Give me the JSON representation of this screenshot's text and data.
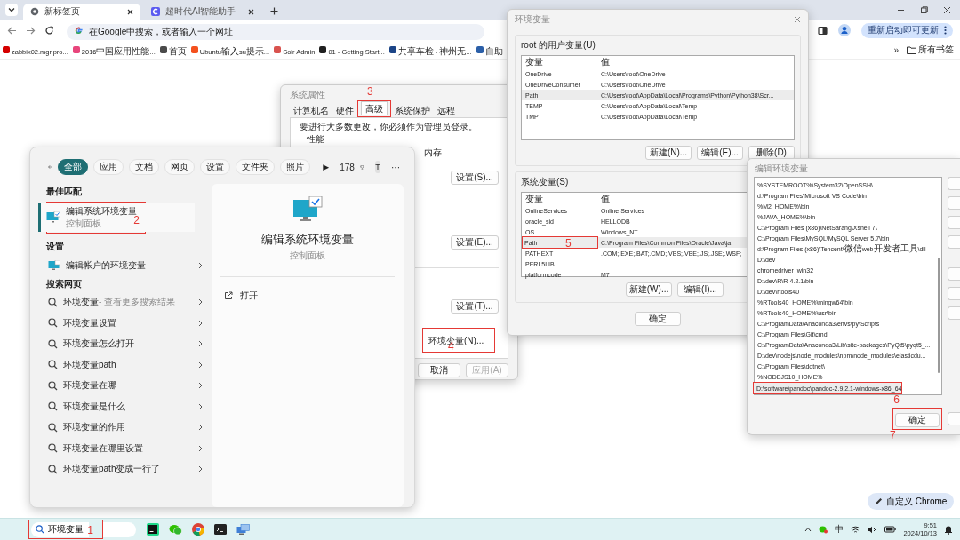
{
  "browser": {
    "tabs": [
      {
        "title": "新标签页",
        "selected": true,
        "kind": "newtab"
      },
      {
        "title": "超时代AI智能助手",
        "selected": false,
        "kind": "assistant"
      }
    ],
    "address_bar": {
      "placeholder": "在Google中搜索，或者输入一个网址"
    },
    "update_button": "重新启动即可更新",
    "bookmarks": [
      {
        "label": "zabbix02.mgr.pro...",
        "color": "#d50000"
      },
      {
        "label": "2016中国应用性能...",
        "color": "#e8457c"
      },
      {
        "label": "首页",
        "color": "#4a4a4a"
      },
      {
        "label": "Ubuntu输入su提示...",
        "color": "#f4511e"
      },
      {
        "label": "Solr Admin",
        "color": "#d9534f"
      },
      {
        "label": "01 - Getting Start...",
        "color": "#202020"
      },
      {
        "label": "共享车检 - 神州无...",
        "color": "#1c4587"
      },
      {
        "label": "自助",
        "color": "#2b5fa8"
      }
    ],
    "bookmarks_overflow": "»",
    "all_bookmarks": "所有书签",
    "customize_button": "自定义 Chrome"
  },
  "system_properties": {
    "title": "系统属性",
    "tabs": [
      {
        "label": "计算机名",
        "selected": false
      },
      {
        "label": "硬件",
        "selected": false
      },
      {
        "label": "高级",
        "selected": true,
        "step": "3"
      },
      {
        "label": "系统保护",
        "selected": false
      },
      {
        "label": "远程",
        "selected": false
      }
    ],
    "notice": "要进行大多数更改，你必须作为管理员登录。",
    "groups": [
      {
        "label": "性能",
        "fragment": "内存",
        "button": "设置(S)..."
      },
      {
        "button": "设置(E)..."
      },
      {
        "button": "设置(T)..."
      }
    ],
    "env_button": {
      "label": "环境变量(N)...",
      "step": "4"
    },
    "footer_buttons": [
      {
        "label": "取消",
        "disabled": false
      },
      {
        "label": "应用(A)",
        "disabled": true
      }
    ]
  },
  "environment_variables": {
    "title": "环境变量",
    "user_section": "root 的用户变量(U)",
    "user_columns": [
      "变量",
      "值"
    ],
    "user_rows": [
      {
        "name": "OneDrive",
        "value": "C:\\Users\\root\\OneDrive",
        "selected": false
      },
      {
        "name": "OneDriveConsumer",
        "value": "C:\\Users\\root\\OneDrive",
        "selected": false
      },
      {
        "name": "Path",
        "value": "C:\\Users\\root\\AppData\\Local\\Programs\\Python\\Python38\\Scr...",
        "selected": true
      },
      {
        "name": "TEMP",
        "value": "C:\\Users\\root\\AppData\\Local\\Temp",
        "selected": false
      },
      {
        "name": "TMP",
        "value": "C:\\Users\\root\\AppData\\Local\\Temp",
        "selected": false
      }
    ],
    "user_buttons": [
      "新建(N)...",
      "编辑(E)...",
      "删除(D)"
    ],
    "system_section": "系统变量(S)",
    "system_columns": [
      "变量",
      "值"
    ],
    "system_rows": [
      {
        "name": "OnlineServices",
        "value": "Online Services",
        "selected": false
      },
      {
        "name": "oracle_sid",
        "value": "HELLODB",
        "selected": false
      },
      {
        "name": "OS",
        "value": "Windows_NT",
        "selected": false
      },
      {
        "name": "Path",
        "value": "C:\\Program Files\\Common Files\\Oracle\\Java\\ja",
        "selected": true,
        "step": "5"
      },
      {
        "name": "PATHEXT",
        "value": ".COM;.EXE;.BAT;.CMD;.VBS;.VBE;.JS;.JSE;.WSF;",
        "selected": false
      },
      {
        "name": "PERL5LIB",
        "value": "",
        "selected": false
      },
      {
        "name": "platformcode",
        "value": "M7",
        "selected": false
      }
    ],
    "system_buttons": [
      "新建(W)...",
      "编辑(I)..."
    ],
    "ok_button": "确定"
  },
  "edit_variable": {
    "title": "编辑环境变量",
    "entries": [
      {
        "text": "%SYSTEMROOT%\\System32\\OpenSSH\\",
        "selected": false
      },
      {
        "text": "d:\\Program Files\\Microsoft VS Code\\bin",
        "selected": false
      },
      {
        "text": "%M2_HOME%\\bin",
        "selected": false
      },
      {
        "text": "%JAVA_HOME%\\bin",
        "selected": false
      },
      {
        "text": "C:\\Program Files (x86)\\NetSarang\\Xshell 7\\",
        "selected": false
      },
      {
        "text": "C:\\Program Files\\MySQL\\MySQL Server 5.7\\bin",
        "selected": false
      },
      {
        "text": "d:\\Program Files (x86)\\Tencent\\微信web开发者工具\\dll",
        "selected": false
      },
      {
        "text": "D:\\dev",
        "selected": false
      },
      {
        "text": "chromedriver_win32",
        "selected": false
      },
      {
        "text": "D:\\dev\\R\\R-4.2.1\\bin",
        "selected": false
      },
      {
        "text": "D:\\dev\\rtools40",
        "selected": false
      },
      {
        "text": "%RTools40_HOME%\\mingw64\\bin",
        "selected": false
      },
      {
        "text": "%RTools40_HOME%\\usr\\bin",
        "selected": false
      },
      {
        "text": "C:\\ProgramData\\Anaconda3\\envs\\py\\Scripts",
        "selected": false
      },
      {
        "text": "C:\\Program Files\\Git\\cmd",
        "selected": false
      },
      {
        "text": "C:\\ProgramData\\Anaconda3\\Lib\\site-packages\\PyQt5\\pyqt5_...",
        "selected": false
      },
      {
        "text": "D:\\dev\\nodejs\\node_modules\\npm\\node_modules\\elasticdu...",
        "selected": false
      },
      {
        "text": "C:\\Program Files\\dotnet\\",
        "selected": false
      },
      {
        "text": "%NODEJS10_HOME%",
        "selected": false
      },
      {
        "text": "D:\\software\\pandoc\\pandoc-2.9.2.1-windows-x86_64",
        "selected": true,
        "step": "6"
      }
    ],
    "ok_button": {
      "label": "确定",
      "step": "7"
    }
  },
  "start_menu": {
    "filters": [
      {
        "label": "全部",
        "selected": true
      },
      {
        "label": "应用",
        "selected": false
      },
      {
        "label": "文档",
        "selected": false
      },
      {
        "label": "网页",
        "selected": false
      },
      {
        "label": "设置",
        "selected": false
      },
      {
        "label": "文件夹",
        "selected": false
      },
      {
        "label": "照片",
        "selected": false
      }
    ],
    "more_filters": "▶",
    "points": "178",
    "avatar": "T",
    "more": "···",
    "best_match_heading": "最佳匹配",
    "best_match": {
      "title": "编辑系统环境变量",
      "subtitle": "控制面板",
      "selected": true,
      "step": "2"
    },
    "settings_heading": "设置",
    "settings_results": [
      "编辑帐户的环境变量"
    ],
    "web_heading": "搜索网页",
    "web_results": [
      {
        "label": "环境变量",
        "hint": "- 查看更多搜索结果"
      },
      {
        "label": "环境变量设置"
      },
      {
        "label": "环境变量怎么打开"
      },
      {
        "label": "环境变量path"
      },
      {
        "label": "环境变量在哪"
      },
      {
        "label": "环境变量是什么"
      },
      {
        "label": "环境变量的作用"
      },
      {
        "label": "环境变量在哪里设置"
      },
      {
        "label": "环境变量path变成一行了"
      }
    ],
    "preview": {
      "title": "编辑系统环境变量",
      "subtitle": "控制面板",
      "actions": [
        "打开"
      ]
    }
  },
  "taskbar": {
    "search": {
      "value": "环境变量",
      "step": "1"
    },
    "input_indicator": "中",
    "time": "9:51",
    "date": "2024/10/13"
  }
}
